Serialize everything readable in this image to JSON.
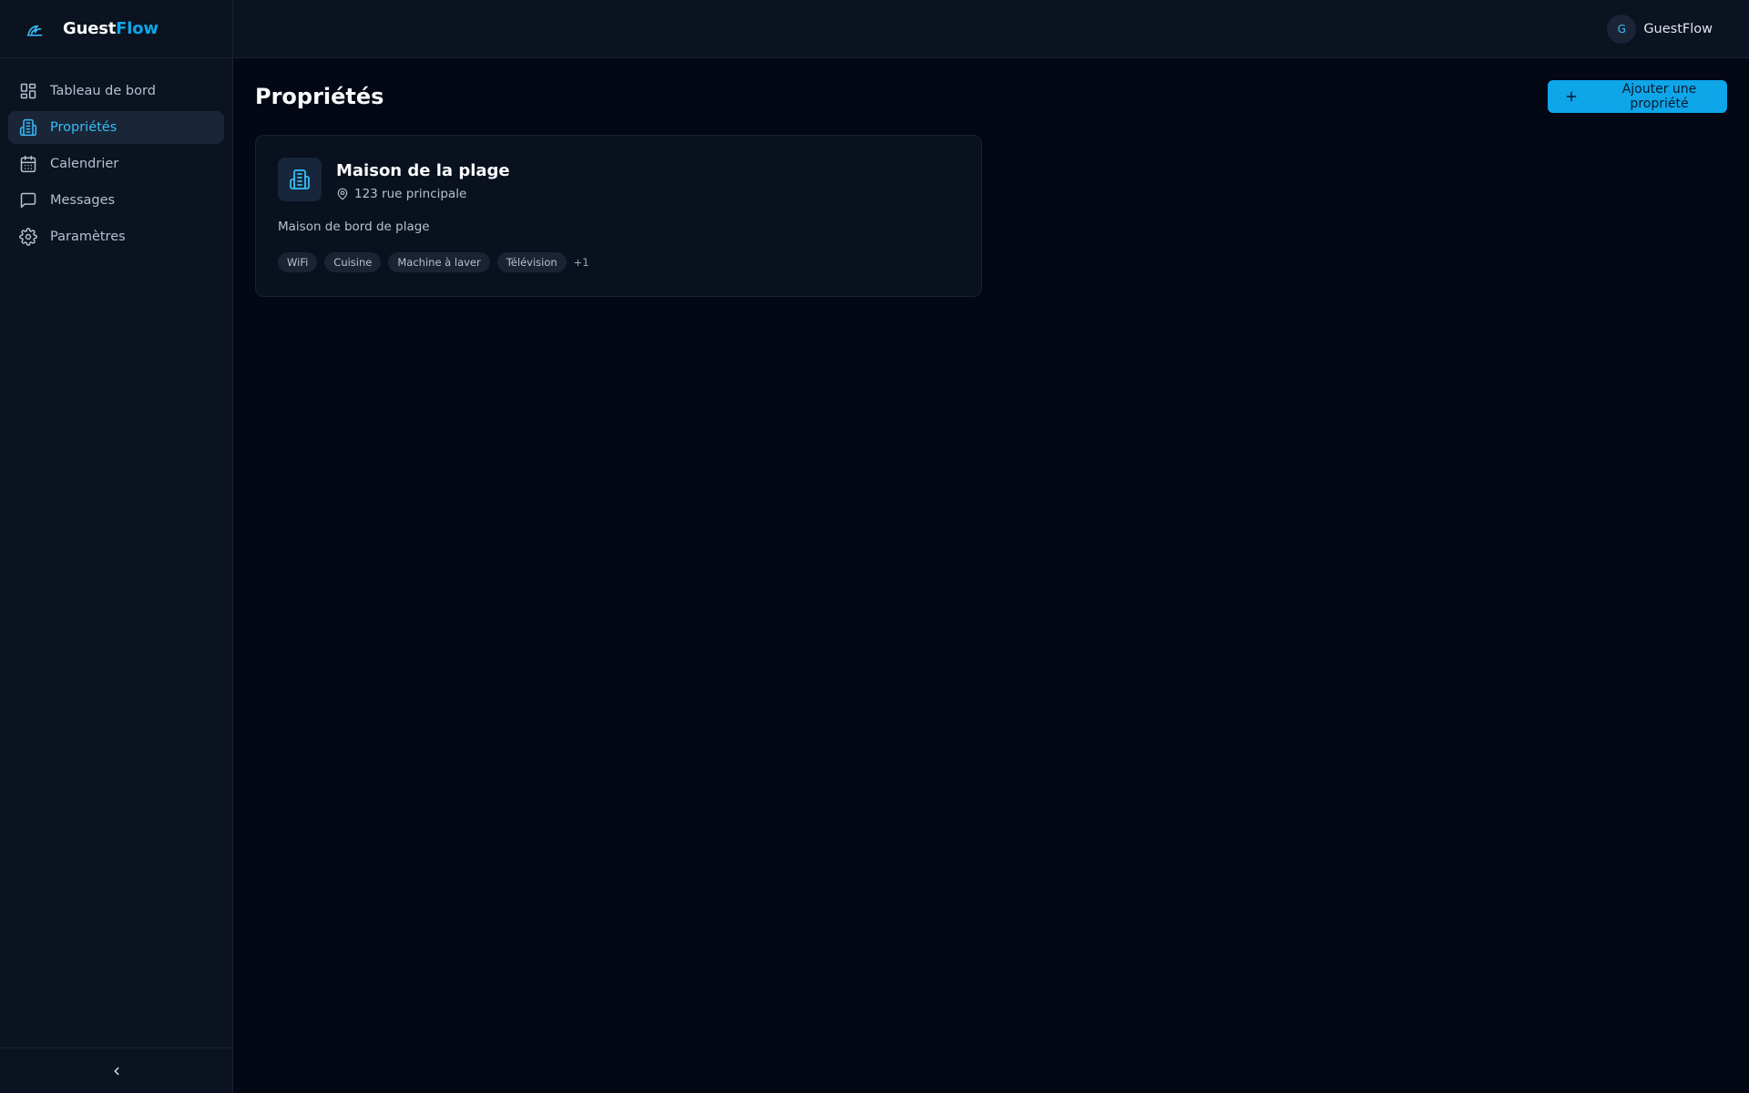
{
  "brand": {
    "name_primary": "Guest",
    "name_accent": "Flow",
    "accent_color": "#0ea5e9"
  },
  "sidebar": {
    "items": [
      {
        "label": "Tableau de bord",
        "icon": "dashboard-icon",
        "active": false
      },
      {
        "label": "Propriétés",
        "icon": "building-icon",
        "active": true
      },
      {
        "label": "Calendrier",
        "icon": "calendar-icon",
        "active": false
      },
      {
        "label": "Messages",
        "icon": "message-icon",
        "active": false
      },
      {
        "label": "Paramètres",
        "icon": "gear-icon",
        "active": false
      }
    ],
    "collapse_icon": "chevron-left-icon"
  },
  "topbar": {
    "user": {
      "avatar_initial": "G",
      "name": "GuestFlow"
    }
  },
  "main": {
    "title": "Propriétés",
    "add_button_label": "Ajouter une propriété",
    "properties": [
      {
        "name": "Maison de la plage",
        "address": "123 rue principale",
        "description": "Maison de bord de plage",
        "amenities": [
          "WiFi",
          "Cuisine",
          "Machine à laver",
          "Télévision"
        ],
        "more_count": "+1"
      }
    ]
  }
}
